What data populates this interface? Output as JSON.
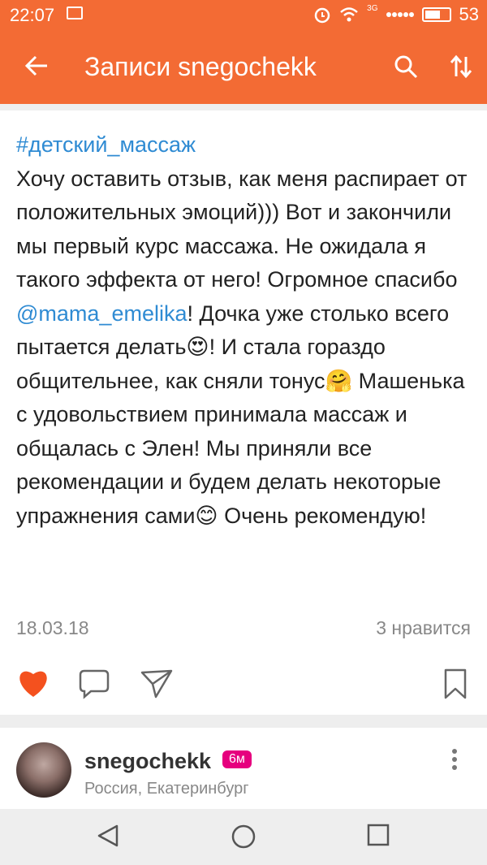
{
  "status_bar": {
    "time": "22:07",
    "network": "3G",
    "battery": "53"
  },
  "app_bar": {
    "title": "Записи snegochekk"
  },
  "post": {
    "hashtag": "#детский_массаж",
    "text_part1": "Хочу оставить отзыв, как меня распирает от положительных эмоций))) Вот и закончили мы первый курс массажа. Не ожидала я такого эффекта от него! Огромное спасибо ",
    "mention": "@mama_emelika",
    "text_part2": "! Дочка уже столько всего пытается делать",
    "emoji1": "😍",
    "text_part3": "! И стала гораздо общительнее, как сняли тонус",
    "emoji2": "🤗",
    "text_part4": " Машенька с удовольствием принимала массаж и общалась с Элен! Мы приняли все рекомендации и будем делать некоторые упражнения сами",
    "emoji3": "😊",
    "text_part5": " Очень рекомендую!",
    "date": "18.03.18",
    "likes": "3 нравится"
  },
  "next_post": {
    "username": "snegochekk",
    "badge": "6м",
    "location": "Россия, Екатеринбург"
  },
  "colors": {
    "brand": "#f36b34",
    "link": "#2f8bd3",
    "like": "#f4511e",
    "badge": "#e6007e"
  },
  "icons": {
    "back": "arrow-left-icon",
    "search": "search-icon",
    "sort": "sort-icon",
    "like": "heart-icon",
    "comment": "comment-icon",
    "share": "share-icon",
    "bookmark": "bookmark-icon",
    "more": "kebab-icon"
  }
}
